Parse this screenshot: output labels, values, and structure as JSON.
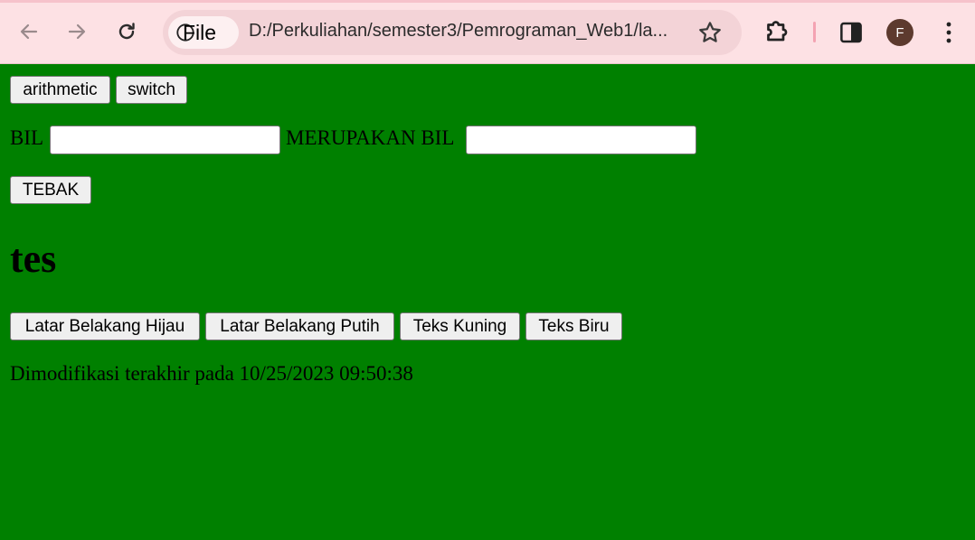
{
  "browser": {
    "site_chip_label": "File",
    "url": "D:/Perkuliahan/semester3/Pemrograman_Web1/la...",
    "profile_initial": "F",
    "colors": {
      "chrome_bg": "#fde1e4",
      "omnibox_bg": "#f3d3d7",
      "avatar_bg": "#5d3a2e"
    }
  },
  "page": {
    "background_color": "#008000",
    "top_buttons": [
      "arithmetic",
      "switch"
    ],
    "bil_label": "BIL",
    "merupakan_label": "MERUPAKAN BIL",
    "bil_input_value": "",
    "result_input_value": "",
    "tebak_label": "TEBAK",
    "heading": "tes",
    "color_buttons": [
      "Latar Belakang Hijau",
      "Latar Belakang Putih",
      "Teks Kuning",
      "Teks Biru"
    ],
    "modified_text": "Dimodifikasi terakhir pada 10/25/2023 09:50:38"
  }
}
